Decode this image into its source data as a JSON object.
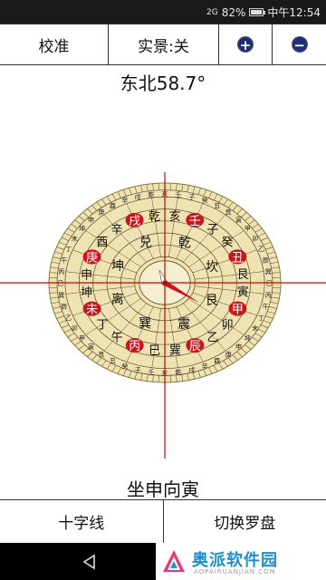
{
  "status": {
    "signal": "2G",
    "battery": "82%",
    "battery_fraction": 0.82,
    "time": "中午12:54"
  },
  "toolbar": {
    "calibrate_label": "校准",
    "realview_label": "实景:关",
    "zoom_in_glyph": "+",
    "zoom_out_glyph": "−"
  },
  "heading": {
    "direction_text": "东北58.7°"
  },
  "compass": {
    "ring_text_red": [
      "亥",
      "壬",
      "子",
      "癸",
      "丑",
      "艮",
      "寅",
      "甲",
      "卯",
      "乙",
      "辰",
      "巽",
      "巳",
      "丙",
      "午",
      "丁",
      "未",
      "坤",
      "申",
      "庚",
      "酉",
      "辛",
      "戌",
      "乾"
    ],
    "inner_ring": [
      "乾",
      "坎",
      "艮",
      "震",
      "巽",
      "离",
      "坤",
      "兑"
    ],
    "highlight_labels": [
      "申",
      "坤",
      "寅",
      "甲",
      "壬",
      "午",
      "乾",
      "戌",
      "乙"
    ],
    "colors": {
      "face": "#efe3b4",
      "ring_red": "#c8161d",
      "needle_red": "#c8161d",
      "crosshair": "#d40000"
    }
  },
  "sitting": {
    "text": "坐申向寅"
  },
  "bottom": {
    "crosshair_label": "十字线",
    "switch_label": "切换罗盘"
  },
  "watermark": {
    "text": "奥派软件园",
    "sub": "AOPAIRUANJIAN.COM"
  }
}
